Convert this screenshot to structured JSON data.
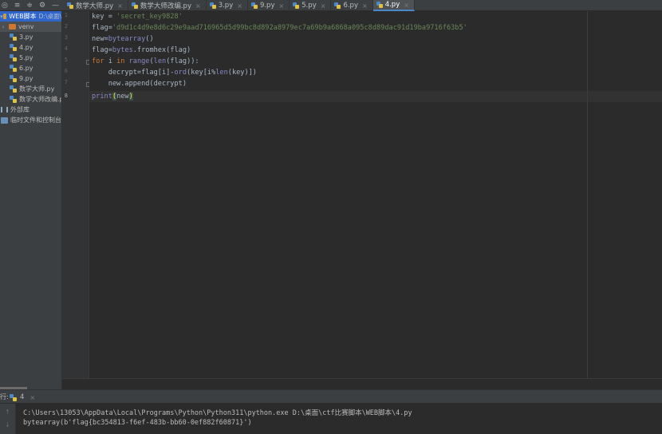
{
  "toolbar": {
    "icons": [
      "target-icon",
      "align-icon",
      "collapse-icon",
      "gear-icon",
      "minimize-icon"
    ]
  },
  "tabs": [
    {
      "label": "数学大师.py",
      "active": false
    },
    {
      "label": "数学大师改编.py",
      "active": false
    },
    {
      "label": "3.py",
      "active": false
    },
    {
      "label": "9.py",
      "active": false
    },
    {
      "label": "5.py",
      "active": false
    },
    {
      "label": "6.py",
      "active": false
    },
    {
      "label": "4.py",
      "active": true
    }
  ],
  "sidebar": {
    "root": {
      "label": "WEB脚本",
      "path": "D:\\桌面\\"
    },
    "items": [
      {
        "label": "venv"
      },
      {
        "label": "3.py"
      },
      {
        "label": "4.py"
      },
      {
        "label": "5.py"
      },
      {
        "label": "6.py"
      },
      {
        "label": "9.py"
      },
      {
        "label": "数学大师.py"
      },
      {
        "label": "数学大师改编.p"
      }
    ],
    "external_libs": "外部库",
    "scratches": "临时文件和控制台"
  },
  "editor": {
    "line_numbers": [
      "1",
      "2",
      "3",
      "4",
      "5",
      "6",
      "7",
      "8"
    ],
    "code": {
      "l1_var": "key = ",
      "l1_str": "'secret_key9828'",
      "l2_var": "flag=",
      "l2_str": "'d9d1c4d9e8d6c29e9aad716965d5d99bc8d892a8979ec7a69b9a6868a095c8d89dac91d19ba9716f63b5'",
      "l3_var": "new=",
      "l3_call": "bytearray",
      "l3_end": "()",
      "l4_var": "flag=",
      "l4_call": "bytes",
      "l4_end": ".fromhex(flag)",
      "l5_for": "for",
      "l5_i": " i ",
      "l5_in": "in",
      "l5_sp": " ",
      "l5_range": "range",
      "l5_p1": "(",
      "l5_len": "len",
      "l5_end": "(flag)):",
      "l6_a": "    decrypt=flag[i]-",
      "l6_ord": "ord",
      "l6_b": "(key[i%",
      "l6_len": "len",
      "l6_c": "(key)])",
      "l7": "    new.append(decrypt)",
      "l8_print": "print",
      "l8_p1": "(",
      "l8_arg": "new",
      "l8_p2": ")"
    }
  },
  "run_panel": {
    "left_label": "行:",
    "tab_label": "4",
    "command": "C:\\Users\\13053\\AppData\\Local\\Programs\\Python\\Python311\\python.exe D:\\桌面\\ctf比赛脚本\\WEB脚本\\4.py",
    "output": "bytearray(b'flag{bc354813-f6ef-483b-bb60-0ef882f60871}')"
  }
}
